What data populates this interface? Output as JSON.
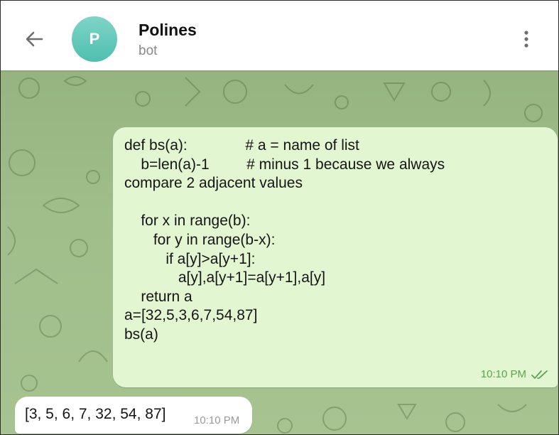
{
  "header": {
    "avatar_letter": "P",
    "title": "Polines",
    "subtitle": "bot",
    "back_icon": "arrow-left-icon",
    "menu_icon": "more-vertical-icon"
  },
  "colors": {
    "avatar": "#5cc6b5",
    "outgoing_bubble": "#e3f6d2",
    "outgoing_time": "#5aa451",
    "chat_background": "#9fbe8a"
  },
  "messages": {
    "outgoing": {
      "text": "def bs(a):              # a = name of list\n    b=len(a)-1         # minus 1 because we always\ncompare 2 adjacent values\n\n    for x in range(b):\n       for y in range(b-x):\n          if a[y]>a[y+1]:\n             a[y],a[y+1]=a[y+1],a[y]\n    return a\na=[32,5,3,6,7,54,87]\nbs(a)",
      "time": "10:10 PM",
      "status_icon": "double-check-icon"
    },
    "incoming": {
      "text": "[3, 5, 6, 7, 32, 54, 87]",
      "time": "10:10 PM"
    }
  }
}
